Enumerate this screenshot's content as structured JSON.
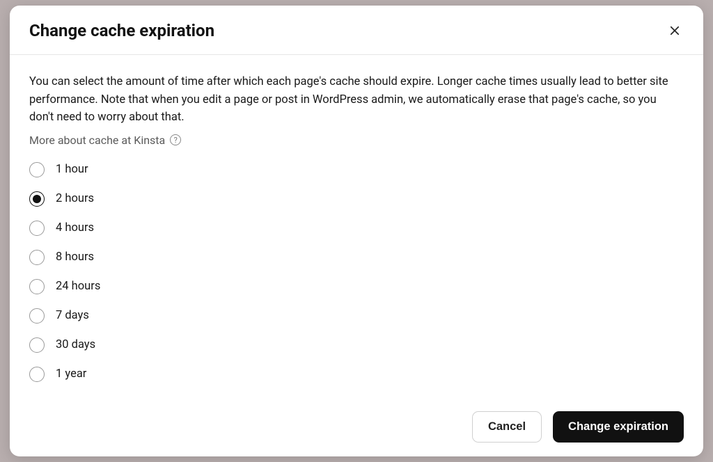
{
  "modal": {
    "title": "Change cache expiration",
    "description": "You can select the amount of time after which each page's cache should expire. Longer cache times usually lead to better site performance. Note that when you edit a page or post in WordPress admin, we automatically erase that page's cache, so you don't need to worry about that.",
    "more_link": "More about cache at Kinsta",
    "options": [
      {
        "label": "1 hour",
        "selected": false
      },
      {
        "label": "2 hours",
        "selected": true
      },
      {
        "label": "4 hours",
        "selected": false
      },
      {
        "label": "8 hours",
        "selected": false
      },
      {
        "label": "24 hours",
        "selected": false
      },
      {
        "label": "7 days",
        "selected": false
      },
      {
        "label": "30 days",
        "selected": false
      },
      {
        "label": "1 year",
        "selected": false
      }
    ],
    "cancel_label": "Cancel",
    "submit_label": "Change expiration"
  }
}
